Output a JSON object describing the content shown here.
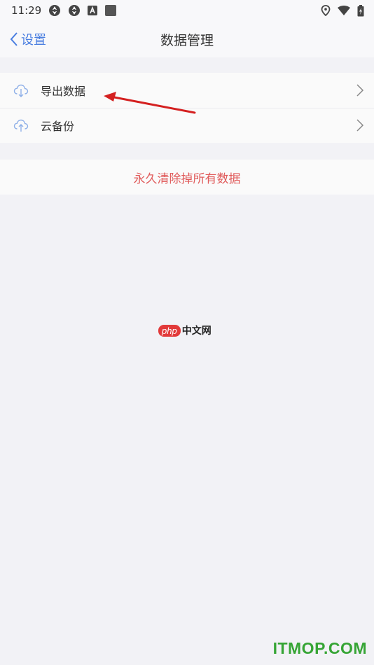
{
  "status_bar": {
    "time": "11:29",
    "icons_left": [
      "aperture-icon",
      "aperture-icon",
      "a-notification-icon",
      "square-notification-icon"
    ],
    "icons_right": [
      "location-icon",
      "wifi-icon",
      "battery-charging-icon"
    ]
  },
  "nav": {
    "back_label": "设置",
    "title": "数据管理",
    "accent_color": "#4a7ee0"
  },
  "list": {
    "items": [
      {
        "label": "导出数据",
        "icon": "cloud-download-icon"
      },
      {
        "label": "云备份",
        "icon": "cloud-upload-icon"
      }
    ]
  },
  "danger": {
    "label": "永久清除掉所有数据",
    "color": "#e05a5a"
  },
  "watermarks": {
    "php_badge": "php",
    "php_text": "中文网",
    "site": "ITMOP.COM"
  }
}
